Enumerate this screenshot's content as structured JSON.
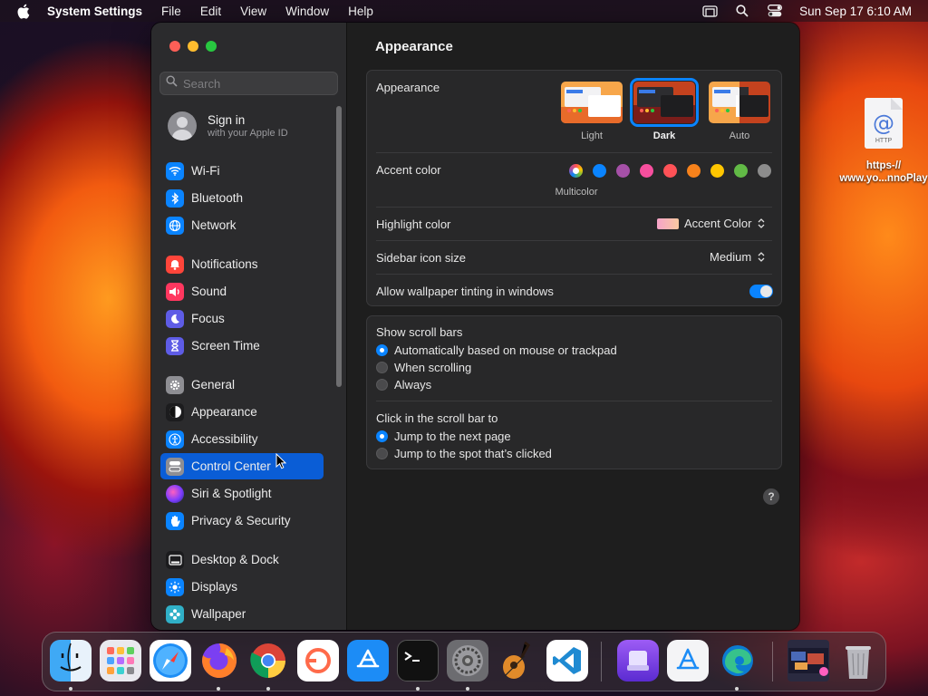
{
  "menubar": {
    "app_name": "System Settings",
    "menus": [
      "File",
      "Edit",
      "View",
      "Window",
      "Help"
    ],
    "datetime": "Sun Sep 17  6:10 AM"
  },
  "sidebar": {
    "search_placeholder": "Search",
    "signin_title": "Sign in",
    "signin_subtitle": "with your Apple ID",
    "items": [
      {
        "label": "Wi-Fi",
        "icon": "wifi-icon",
        "color": "#0a84ff"
      },
      {
        "label": "Bluetooth",
        "icon": "bluetooth-icon",
        "color": "#0a84ff"
      },
      {
        "label": "Network",
        "icon": "globe-icon",
        "color": "#0a84ff"
      },
      {
        "label": "Notifications",
        "icon": "bell-icon",
        "color": "#ff453a"
      },
      {
        "label": "Sound",
        "icon": "speaker-icon",
        "color": "#ff375f"
      },
      {
        "label": "Focus",
        "icon": "moon-icon",
        "color": "#5e5ce6"
      },
      {
        "label": "Screen Time",
        "icon": "hourglass-icon",
        "color": "#5e5ce6"
      },
      {
        "label": "General",
        "icon": "gear-icon",
        "color": "#8e8e93"
      },
      {
        "label": "Appearance",
        "icon": "appearance-icon",
        "color": "#1c1c1e"
      },
      {
        "label": "Accessibility",
        "icon": "accessibility-icon",
        "color": "#0a84ff"
      },
      {
        "label": "Control Center",
        "icon": "control-center-icon",
        "color": "#8e8e93"
      },
      {
        "label": "Siri & Spotlight",
        "icon": "siri-icon",
        "color": "#bf5af2"
      },
      {
        "label": "Privacy & Security",
        "icon": "hand-icon",
        "color": "#0a84ff"
      },
      {
        "label": "Desktop & Dock",
        "icon": "dock-icon",
        "color": "#1c1c1e"
      },
      {
        "label": "Displays",
        "icon": "sun-icon",
        "color": "#0a84ff"
      },
      {
        "label": "Wallpaper",
        "icon": "wallpaper-icon",
        "color": "#30b0c7"
      }
    ],
    "active": "Control Center"
  },
  "main": {
    "title": "Appearance",
    "appearance_label": "Appearance",
    "appearance_options": [
      "Light",
      "Dark",
      "Auto"
    ],
    "appearance_selected": "Dark",
    "accent_label": "Accent color",
    "accent_colors": [
      "multicolor",
      "#0a84ff",
      "#a550a7",
      "#f74f9e",
      "#ff5257",
      "#f7821b",
      "#ffc600",
      "#62ba46",
      "#8c8c8c"
    ],
    "accent_selected_label": "Multicolor",
    "highlight_label": "Highlight color",
    "highlight_value": "Accent Color",
    "icon_size_label": "Sidebar icon size",
    "icon_size_value": "Medium",
    "tinting_label": "Allow wallpaper tinting in windows",
    "tinting_on": true,
    "scroll_title": "Show scroll bars",
    "scroll_options": [
      "Automatically based on mouse or trackpad",
      "When scrolling",
      "Always"
    ],
    "click_title": "Click in the scroll bar to",
    "click_options": [
      "Jump to the next page",
      "Jump to the spot that’s clicked"
    ],
    "help": "?"
  },
  "desktop_file": {
    "name_line1": "https-//",
    "name_line2": "www.yo...nnoPlay",
    "badge": "HTTP"
  },
  "dock": {
    "apps": [
      "finder-icon",
      "launchpad-icon",
      "safari-icon",
      "firefox-icon",
      "chrome-icon",
      "bezel-icon",
      "app-store-icon",
      "terminal-icon",
      "system-settings-icon",
      "garageband-icon",
      "vscode-icon",
      "bootcamp-icon",
      "xcode-instruments-icon",
      "edge-icon",
      "screenshot-folder-icon",
      "trash-icon"
    ]
  }
}
